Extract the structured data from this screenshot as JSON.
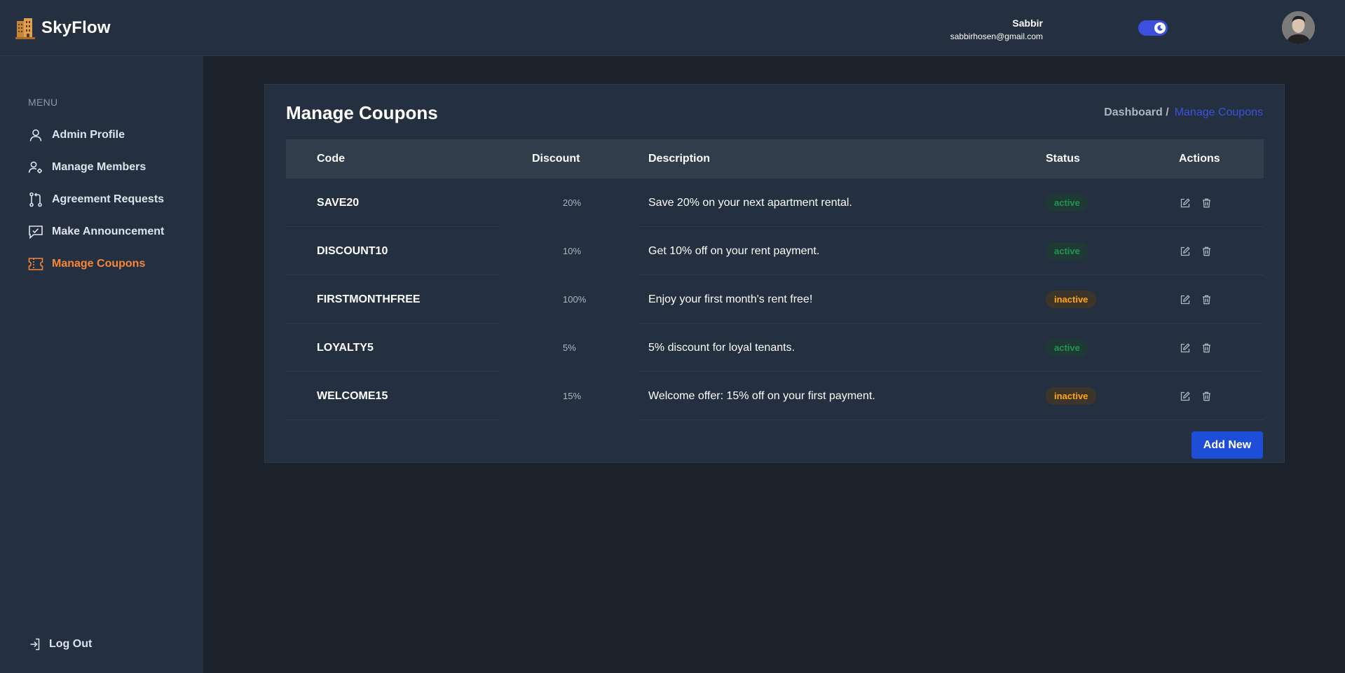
{
  "brand": {
    "name": "SkyFlow",
    "logo_icon": "building-icon"
  },
  "user": {
    "name": "Sabbir",
    "email": "sabbirhosen@gmail.com"
  },
  "theme_toggle": {
    "state": "dark",
    "icon": "moon-icon",
    "accent": "#3c50e0"
  },
  "sidebar": {
    "menu_title": "MENU",
    "items": [
      {
        "label": "Admin Profile",
        "icon": "user-icon",
        "active": false
      },
      {
        "label": "Manage Members",
        "icon": "users-gear-icon",
        "active": false
      },
      {
        "label": "Agreement Requests",
        "icon": "git-pull-request-icon",
        "active": false
      },
      {
        "label": "Make Announcement",
        "icon": "announcement-icon",
        "active": false
      },
      {
        "label": "Manage Coupons",
        "icon": "ticket-icon",
        "active": true
      }
    ],
    "logout_label": "Log Out"
  },
  "main": {
    "title": "Manage Coupons",
    "breadcrumb": {
      "parent": "Dashboard /",
      "current": "Manage Coupons"
    },
    "table": {
      "headers": {
        "code": "Code",
        "discount": "Discount",
        "description": "Description",
        "status": "Status",
        "actions": "Actions"
      },
      "rows": [
        {
          "code": "SAVE20",
          "discount": "20%",
          "description": "Save 20% on your next apartment rental.",
          "status": "active"
        },
        {
          "code": "DISCOUNT10",
          "discount": "10%",
          "description": "Get 10% off on your rent payment.",
          "status": "active"
        },
        {
          "code": "FIRSTMONTHFREE",
          "discount": "100%",
          "description": "Enjoy your first month's rent free!",
          "status": "inactive"
        },
        {
          "code": "LOYALTY5",
          "discount": "5%",
          "description": "5% discount for loyal tenants.",
          "status": "active"
        },
        {
          "code": "WELCOME15",
          "discount": "15%",
          "description": "Welcome offer: 15% off on your first payment.",
          "status": "inactive"
        }
      ]
    },
    "add_button_label": "Add New"
  },
  "colors": {
    "active_menu": "#f7863a",
    "primary": "#1c4ed8",
    "status_active": "#219653",
    "status_inactive": "#ffa70b"
  }
}
